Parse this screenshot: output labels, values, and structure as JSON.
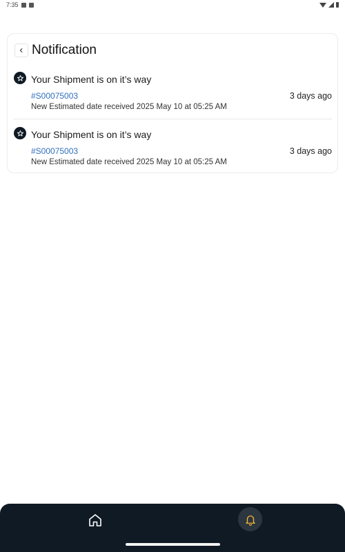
{
  "status_bar": {
    "time": "7:35"
  },
  "header": {
    "title": "Notification"
  },
  "notifications": [
    {
      "title": "Your Shipment is on it’s way",
      "shipment_id": "#S00075003",
      "time_ago": "3 days ago",
      "description": "New Estimated date received 2025 May 10 at 05:25 AM",
      "icon": "star-icon"
    },
    {
      "title": "Your Shipment is on it’s way",
      "shipment_id": "#S00075003",
      "time_ago": "3 days ago",
      "description": "New Estimated date received 2025 May 10 at 05:25 AM",
      "icon": "star-icon"
    }
  ],
  "bottom_nav": {
    "items": [
      {
        "icon": "home-icon",
        "active": false
      },
      {
        "icon": "bell-icon",
        "active": true
      }
    ]
  },
  "colors": {
    "nav_background": "#0f1a24",
    "link": "#2f6fbe",
    "active_icon": "#f2b630"
  }
}
